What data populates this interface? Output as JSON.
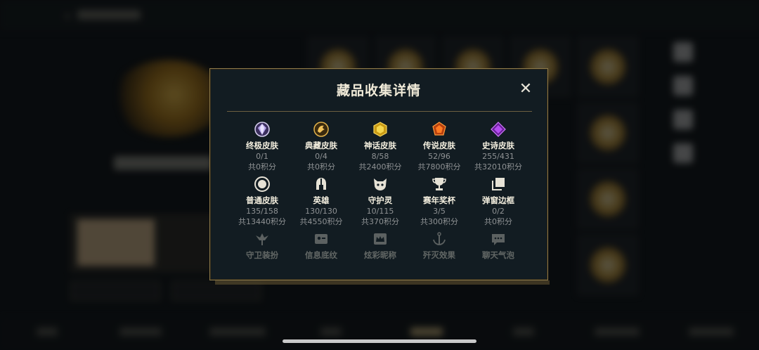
{
  "dialog": {
    "title": "藏品收集详情",
    "close_label": "✕"
  },
  "rows": [
    [
      {
        "name": "终极皮肤",
        "count": "0/1",
        "points": "共0积分",
        "icon": "ultimate-gem-icon"
      },
      {
        "name": "典藏皮肤",
        "count": "0/4",
        "points": "共0积分",
        "icon": "collection-dragon-icon"
      },
      {
        "name": "神话皮肤",
        "count": "8/58",
        "points": "共2400积分",
        "icon": "mythic-gem-icon"
      },
      {
        "name": "传说皮肤",
        "count": "52/96",
        "points": "共7800积分",
        "icon": "legendary-gem-icon"
      },
      {
        "name": "史诗皮肤",
        "count": "255/431",
        "points": "共32010积分",
        "icon": "epic-gem-icon"
      }
    ],
    [
      {
        "name": "普通皮肤",
        "count": "135/158",
        "points": "共13440积分",
        "icon": "normal-circle-icon"
      },
      {
        "name": "英雄",
        "count": "130/130",
        "points": "共4550积分",
        "icon": "helmet-icon"
      },
      {
        "name": "守护灵",
        "count": "10/115",
        "points": "共370积分",
        "icon": "guardian-pet-icon"
      },
      {
        "name": "赛年奖杯",
        "count": "3/5",
        "points": "共300积分",
        "icon": "trophy-icon"
      },
      {
        "name": "弹窗边框",
        "count": "0/2",
        "points": "共0积分",
        "icon": "frame-stack-icon"
      }
    ],
    [
      {
        "name": "守卫装扮",
        "icon": "ward-icon"
      },
      {
        "name": "信息底纹",
        "icon": "info-card-icon"
      },
      {
        "name": "炫彩昵称",
        "icon": "nickname-crown-icon"
      },
      {
        "name": "歼灭效果",
        "icon": "anchor-icon"
      },
      {
        "name": "聊天气泡",
        "icon": "chat-bubble-icon"
      }
    ]
  ]
}
